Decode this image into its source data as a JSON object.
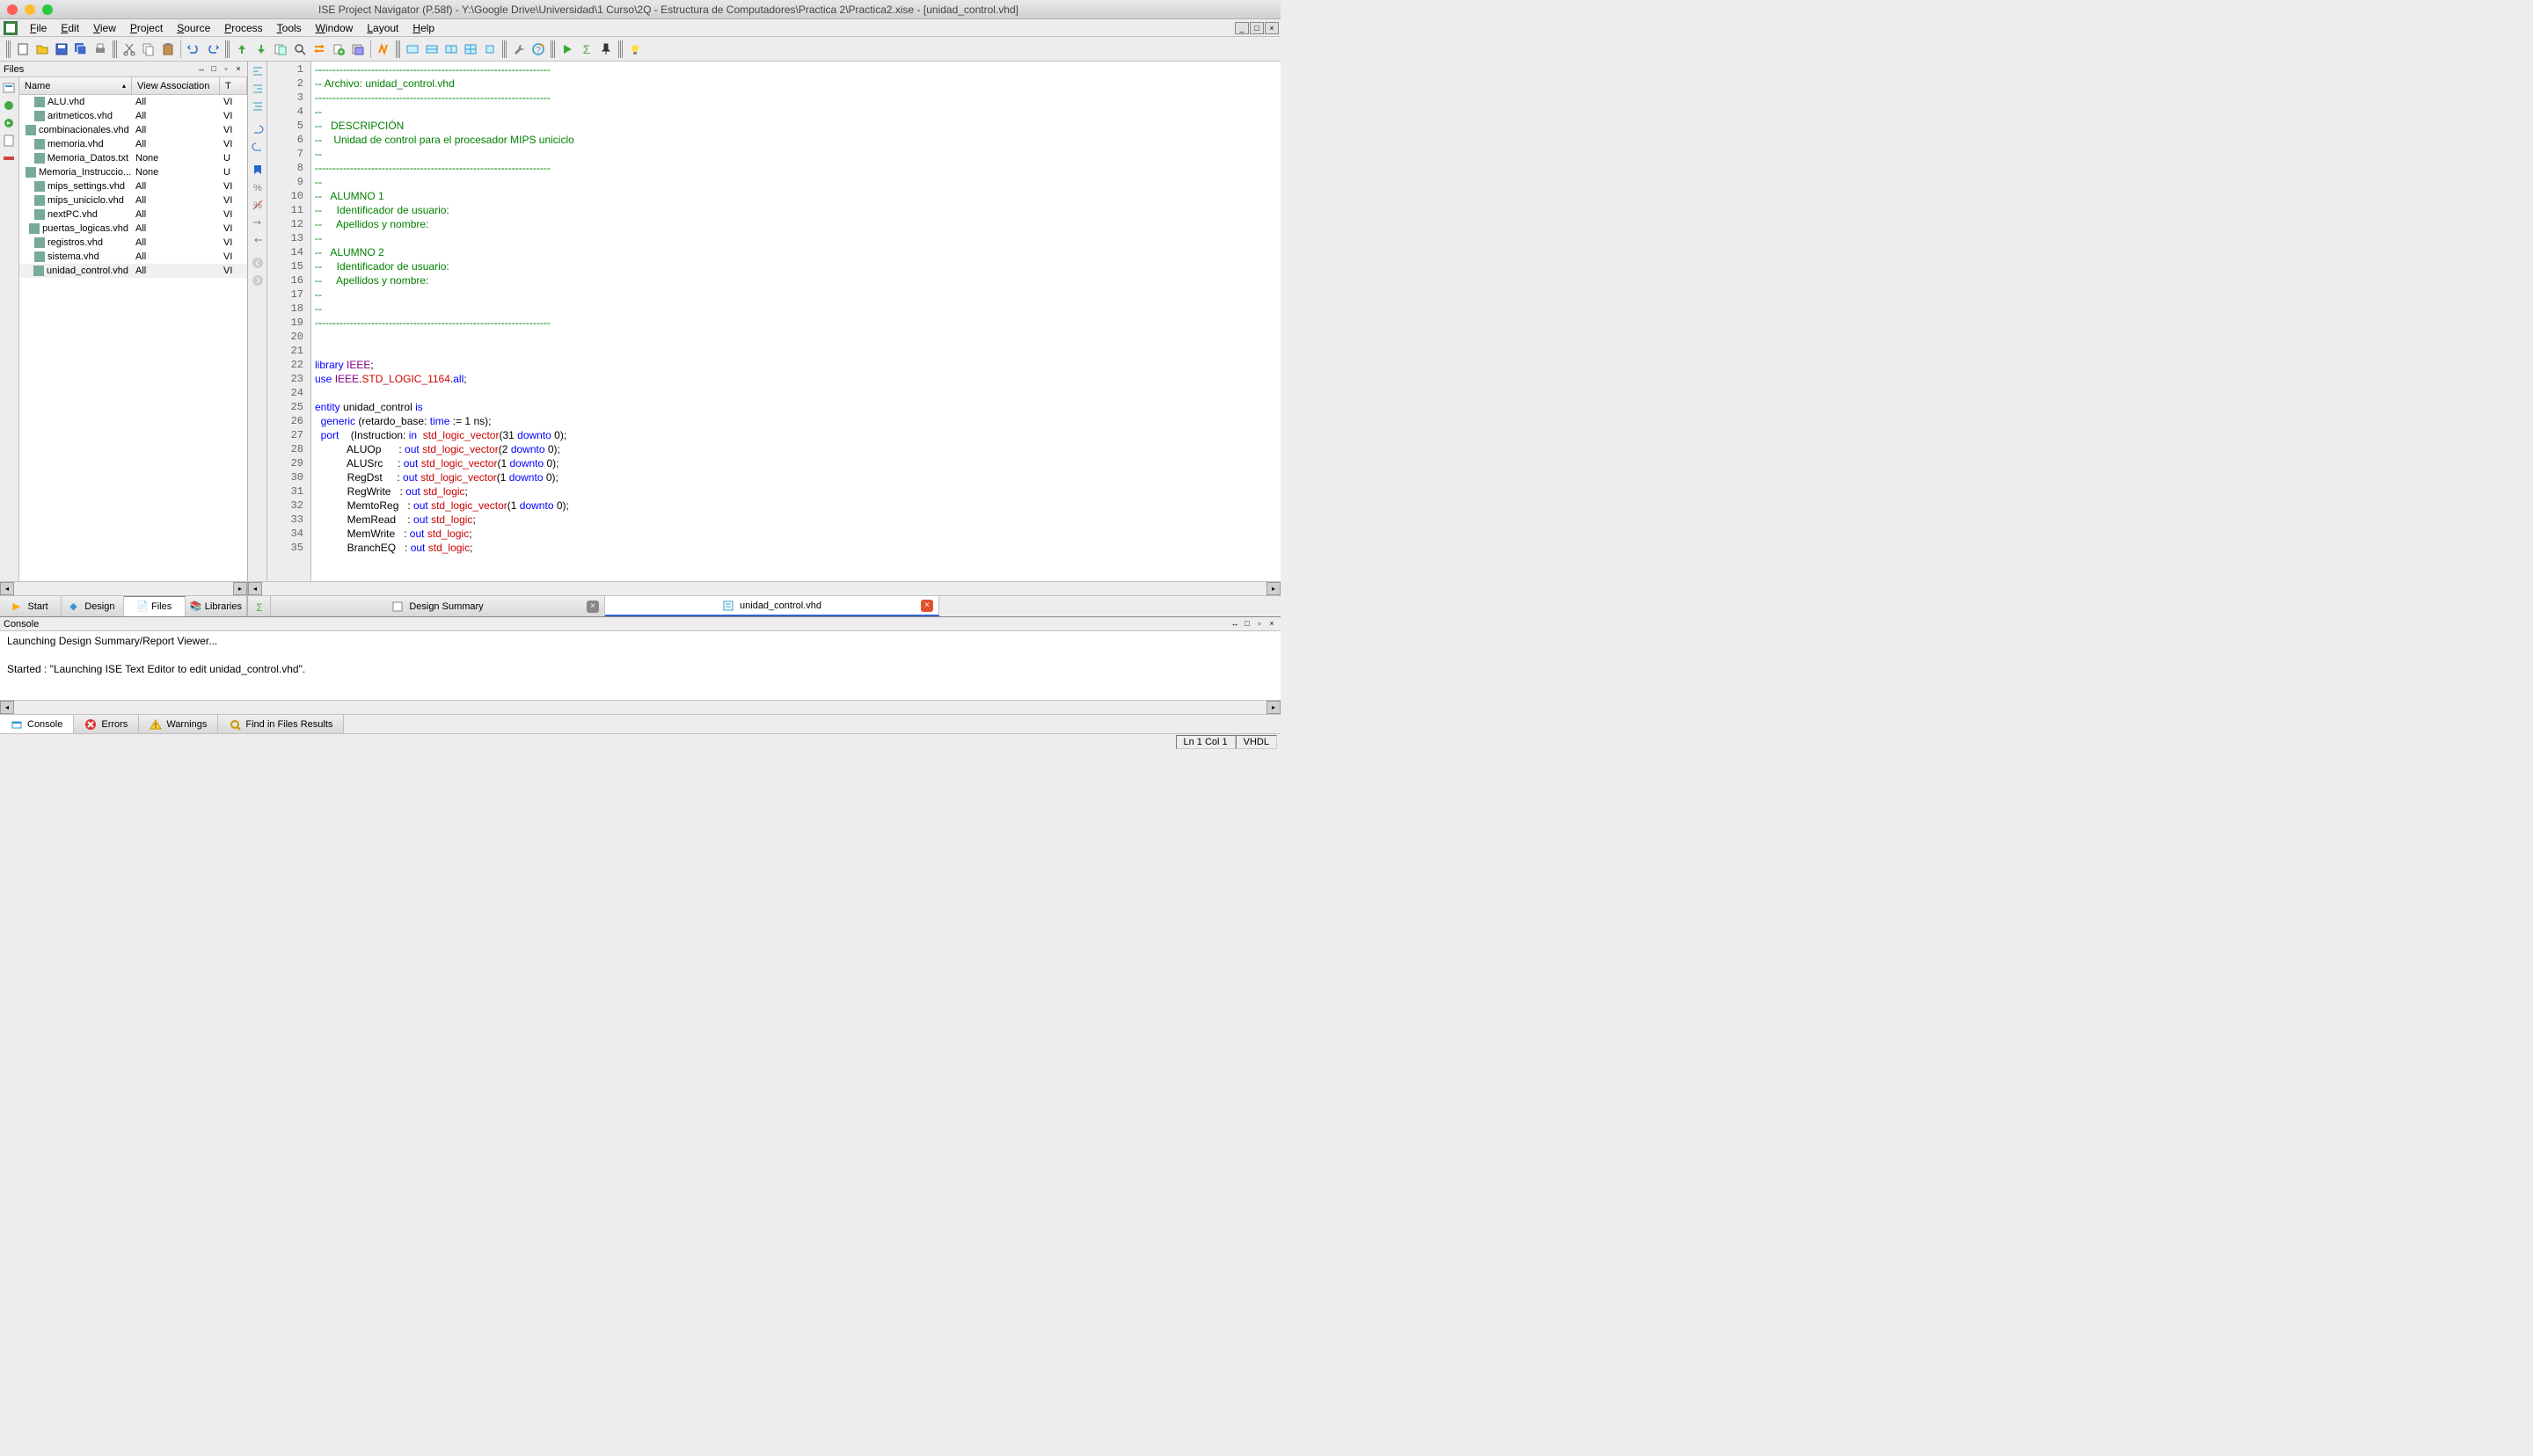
{
  "title": "ISE Project Navigator (P.58f) - Y:\\Google Drive\\Universidad\\1 Curso\\2Q - Estructura de Computadores\\Practica 2\\Practica2.xise - [unidad_control.vhd]",
  "menu": [
    "File",
    "Edit",
    "View",
    "Project",
    "Source",
    "Process",
    "Tools",
    "Window",
    "Layout",
    "Help"
  ],
  "files_panel": {
    "title": "Files",
    "columns": [
      "Name",
      "View Association",
      "T"
    ],
    "rows": [
      {
        "name": "ALU.vhd",
        "view": "All",
        "t": "VI"
      },
      {
        "name": "aritmeticos.vhd",
        "view": "All",
        "t": "VI"
      },
      {
        "name": "combinacionales.vhd",
        "view": "All",
        "t": "VI"
      },
      {
        "name": "memoria.vhd",
        "view": "All",
        "t": "VI"
      },
      {
        "name": "Memoria_Datos.txt",
        "view": "None",
        "t": "U"
      },
      {
        "name": "Memoria_Instruccio...",
        "view": "None",
        "t": "U"
      },
      {
        "name": "mips_settings.vhd",
        "view": "All",
        "t": "VI"
      },
      {
        "name": "mips_uniciclo.vhd",
        "view": "All",
        "t": "VI"
      },
      {
        "name": "nextPC.vhd",
        "view": "All",
        "t": "VI"
      },
      {
        "name": "puertas_logicas.vhd",
        "view": "All",
        "t": "VI"
      },
      {
        "name": "registros.vhd",
        "view": "All",
        "t": "VI"
      },
      {
        "name": "sistema.vhd",
        "view": "All",
        "t": "VI"
      },
      {
        "name": "unidad_control.vhd",
        "view": "All",
        "t": "VI"
      }
    ]
  },
  "left_tabs": [
    "Start",
    "Design",
    "Files",
    "Libraries"
  ],
  "editor_tabs": [
    {
      "label": "Design Summary",
      "active": false
    },
    {
      "label": "unidad_control.vhd",
      "active": true
    }
  ],
  "code": {
    "lines": [
      [
        {
          "t": "-------------------------------------------------------------------",
          "cls": "c-comment"
        }
      ],
      [
        {
          "t": "-- Archivo: unidad_control.vhd",
          "cls": "c-comment"
        }
      ],
      [
        {
          "t": "-------------------------------------------------------------------",
          "cls": "c-comment"
        }
      ],
      [
        {
          "t": "--",
          "cls": "c-comment"
        }
      ],
      [
        {
          "t": "--   DESCRIPCIÓN",
          "cls": "c-comment"
        }
      ],
      [
        {
          "t": "--    Unidad de control para el procesador MIPS uniciclo",
          "cls": "c-comment"
        }
      ],
      [
        {
          "t": "--",
          "cls": "c-comment"
        }
      ],
      [
        {
          "t": "-------------------------------------------------------------------",
          "cls": "c-comment"
        }
      ],
      [
        {
          "t": "--",
          "cls": "c-comment"
        }
      ],
      [
        {
          "t": "--   ALUMNO 1",
          "cls": "c-comment"
        }
      ],
      [
        {
          "t": "--     Identificador de usuario:",
          "cls": "c-comment"
        }
      ],
      [
        {
          "t": "--     Apellidos y nombre:",
          "cls": "c-comment"
        }
      ],
      [
        {
          "t": "--",
          "cls": "c-comment"
        }
      ],
      [
        {
          "t": "--   ALUMNO 2",
          "cls": "c-comment"
        }
      ],
      [
        {
          "t": "--     Identificador de usuario:",
          "cls": "c-comment"
        }
      ],
      [
        {
          "t": "--     Apellidos y nombre:",
          "cls": "c-comment"
        }
      ],
      [
        {
          "t": "--",
          "cls": "c-comment"
        }
      ],
      [
        {
          "t": "--",
          "cls": "c-comment"
        }
      ],
      [
        {
          "t": "-------------------------------------------------------------------",
          "cls": "c-comment"
        }
      ],
      [],
      [],
      [
        {
          "t": "library",
          "cls": "c-keyword"
        },
        {
          "t": " IEEE",
          "cls": "c-keyword2"
        },
        {
          "t": ";",
          "cls": "c-ident"
        }
      ],
      [
        {
          "t": "use",
          "cls": "c-keyword"
        },
        {
          "t": " IEEE",
          "cls": "c-keyword2"
        },
        {
          "t": ".",
          "cls": "c-ident"
        },
        {
          "t": "STD_LOGIC_1164",
          "cls": "c-type"
        },
        {
          "t": ".",
          "cls": "c-ident"
        },
        {
          "t": "all",
          "cls": "c-keyword"
        },
        {
          "t": ";",
          "cls": "c-ident"
        }
      ],
      [],
      [
        {
          "t": "entity",
          "cls": "c-keyword"
        },
        {
          "t": " unidad_control ",
          "cls": "c-ident"
        },
        {
          "t": "is",
          "cls": "c-keyword"
        }
      ],
      [
        {
          "t": "  ",
          "cls": ""
        },
        {
          "t": "generic",
          "cls": "c-keyword"
        },
        {
          "t": " (retardo_base: ",
          "cls": "c-ident"
        },
        {
          "t": "time",
          "cls": "c-keyword"
        },
        {
          "t": " := 1 ns);",
          "cls": "c-ident"
        }
      ],
      [
        {
          "t": "  ",
          "cls": ""
        },
        {
          "t": "port",
          "cls": "c-keyword"
        },
        {
          "t": "    (Instruction: ",
          "cls": "c-ident"
        },
        {
          "t": "in",
          "cls": "c-keyword"
        },
        {
          "t": "  ",
          "cls": ""
        },
        {
          "t": "std_logic_vector",
          "cls": "c-type"
        },
        {
          "t": "(31 ",
          "cls": "c-ident"
        },
        {
          "t": "downto",
          "cls": "c-keyword"
        },
        {
          "t": " 0);",
          "cls": "c-ident"
        }
      ],
      [
        {
          "t": "           ALUOp      : ",
          "cls": "c-ident"
        },
        {
          "t": "out",
          "cls": "c-keyword"
        },
        {
          "t": " ",
          "cls": ""
        },
        {
          "t": "std_logic_vector",
          "cls": "c-type"
        },
        {
          "t": "(2 ",
          "cls": "c-ident"
        },
        {
          "t": "downto",
          "cls": "c-keyword"
        },
        {
          "t": " 0);",
          "cls": "c-ident"
        }
      ],
      [
        {
          "t": "           ALUSrc     : ",
          "cls": "c-ident"
        },
        {
          "t": "out",
          "cls": "c-keyword"
        },
        {
          "t": " ",
          "cls": ""
        },
        {
          "t": "std_logic_vector",
          "cls": "c-type"
        },
        {
          "t": "(1 ",
          "cls": "c-ident"
        },
        {
          "t": "downto",
          "cls": "c-keyword"
        },
        {
          "t": " 0);",
          "cls": "c-ident"
        }
      ],
      [
        {
          "t": "           RegDst     : ",
          "cls": "c-ident"
        },
        {
          "t": "out",
          "cls": "c-keyword"
        },
        {
          "t": " ",
          "cls": ""
        },
        {
          "t": "std_logic_vector",
          "cls": "c-type"
        },
        {
          "t": "(1 ",
          "cls": "c-ident"
        },
        {
          "t": "downto",
          "cls": "c-keyword"
        },
        {
          "t": " 0);",
          "cls": "c-ident"
        }
      ],
      [
        {
          "t": "           RegWrite   : ",
          "cls": "c-ident"
        },
        {
          "t": "out",
          "cls": "c-keyword"
        },
        {
          "t": " ",
          "cls": ""
        },
        {
          "t": "std_logic",
          "cls": "c-type"
        },
        {
          "t": ";",
          "cls": "c-ident"
        }
      ],
      [
        {
          "t": "           MemtoReg   : ",
          "cls": "c-ident"
        },
        {
          "t": "out",
          "cls": "c-keyword"
        },
        {
          "t": " ",
          "cls": ""
        },
        {
          "t": "std_logic_vector",
          "cls": "c-type"
        },
        {
          "t": "(1 ",
          "cls": "c-ident"
        },
        {
          "t": "downto",
          "cls": "c-keyword"
        },
        {
          "t": " 0);",
          "cls": "c-ident"
        }
      ],
      [
        {
          "t": "           MemRead    : ",
          "cls": "c-ident"
        },
        {
          "t": "out",
          "cls": "c-keyword"
        },
        {
          "t": " ",
          "cls": ""
        },
        {
          "t": "std_logic",
          "cls": "c-type"
        },
        {
          "t": ";",
          "cls": "c-ident"
        }
      ],
      [
        {
          "t": "           MemWrite   : ",
          "cls": "c-ident"
        },
        {
          "t": "out",
          "cls": "c-keyword"
        },
        {
          "t": " ",
          "cls": ""
        },
        {
          "t": "std_logic",
          "cls": "c-type"
        },
        {
          "t": ";",
          "cls": "c-ident"
        }
      ],
      [
        {
          "t": "           BranchEQ   : ",
          "cls": "c-ident"
        },
        {
          "t": "out",
          "cls": "c-keyword"
        },
        {
          "t": " ",
          "cls": ""
        },
        {
          "t": "std_logic",
          "cls": "c-type"
        },
        {
          "t": ";",
          "cls": "c-ident"
        }
      ]
    ]
  },
  "console": {
    "title": "Console",
    "lines": [
      "Launching Design Summary/Report Viewer...",
      "",
      "Started : \"Launching ISE Text Editor to edit unidad_control.vhd\"."
    ]
  },
  "bottom_tabs": [
    "Console",
    "Errors",
    "Warnings",
    "Find in Files Results"
  ],
  "status": {
    "pos": "Ln 1 Col 1",
    "lang": "VHDL"
  }
}
